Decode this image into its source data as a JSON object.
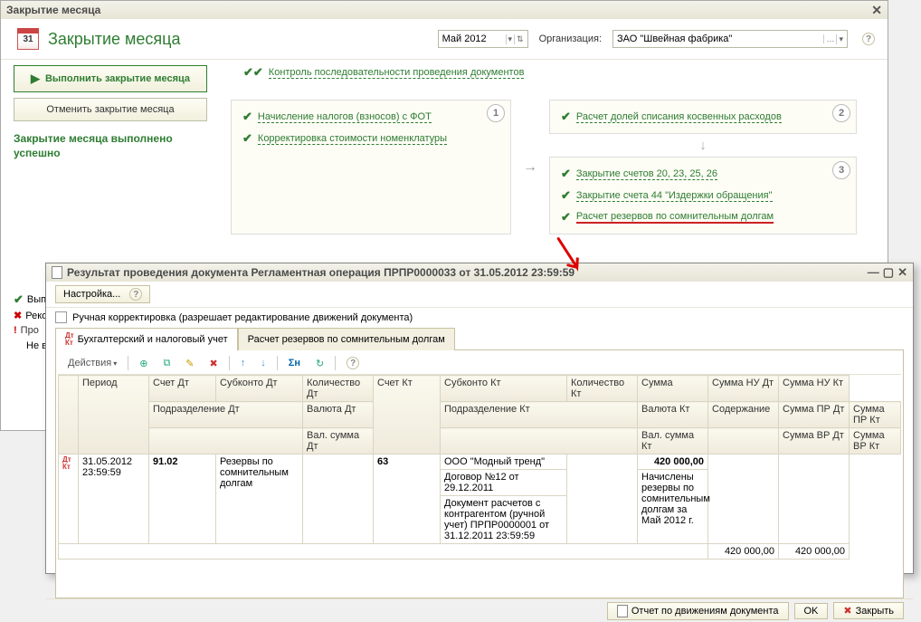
{
  "main": {
    "title": "Закрытие месяца",
    "page_title": "Закрытие месяца",
    "month": "Май 2012",
    "org_label": "Организация:",
    "org_value": "ЗАО \"Швейная фабрика\"",
    "cal_num": "31",
    "exec_btn": "Выполнить закрытие месяца",
    "cancel_btn": "Отменить закрытие месяца",
    "success": "Закрытие месяца выполнено успешно",
    "control_link": "Контроль последовательности проведения документов",
    "panel1": {
      "num": "1",
      "i1": "Начисление налогов (взносов) с ФОТ",
      "i2": "Корректировка стоимости номенклатуры"
    },
    "panel2": {
      "num": "2",
      "i1": "Расчет долей списания косвенных расходов"
    },
    "panel3": {
      "num": "3",
      "i1": "Закрытие счетов 20, 23, 25, 26",
      "i2": "Закрытие счета 44 \"Издержки обращения\"",
      "i3": "Расчет резервов по сомнительным долгам"
    },
    "bl1": "Вып",
    "bl2": "Реко",
    "bl3": "Про",
    "bl4": "Не в"
  },
  "doc": {
    "title": "Результат проведения документа Регламентная операция ПРПР0000033 от 31.05.2012 23:59:59",
    "settings_btn": "Настройка...",
    "manual_label": "Ручная корректировка (разрешает редактирование движений документа)",
    "tab1": "Бухгалтерский и налоговый учет",
    "tab2": "Расчет резервов по сомнительным долгам",
    "actions": "Действия",
    "headers": {
      "period": "Период",
      "acc_dt": "Счет Дт",
      "sub_dt": "Субконто Дт",
      "qty_dt": "Количество Дт",
      "acc_kt": "Счет Кт",
      "sub_kt": "Субконто Кт",
      "qty_kt": "Количество Кт",
      "sum": "Сумма",
      "sum_nu_dt": "Сумма НУ Дт",
      "sum_nu_kt": "Сумма НУ Кт",
      "division_dt": "Подразделение Дт",
      "cur_dt": "Валюта Дт",
      "division_kt": "Подразделение Кт",
      "cur_kt": "Валюта Кт",
      "desc": "Содержание",
      "sum_pr_dt": "Сумма ПР Дт",
      "sum_pr_kt": "Сумма ПР Кт",
      "cur_sum_dt": "Вал. сумма Дт",
      "cur_sum_kt": "Вал. сумма Кт",
      "sum_vr_dt": "Сумма ВР Дт",
      "sum_vr_kt": "Сумма ВР Кт"
    },
    "row": {
      "period": "31.05.2012 23:59:59",
      "acc_dt": "91.02",
      "sub_dt": "Резервы по сомнительным долгам",
      "acc_kt": "63",
      "sub_kt1": "ООО \"Модный тренд\"",
      "sub_kt2": "Договор №12 от 29.12.2011",
      "sub_kt3": "Документ расчетов с контрагентом (ручной учет) ПРПР0000001 от 31.12.2011 23:59:59",
      "sum": "420 000,00",
      "desc": "Начислены резервы по сомнительным долгам за Май 2012 г.",
      "sum_nu_dt": "420 000,00",
      "sum_nu_kt": "420 000,00"
    },
    "footer": {
      "report": "Отчет по движениям документа",
      "ok": "OK",
      "close": "Закрыть"
    }
  }
}
